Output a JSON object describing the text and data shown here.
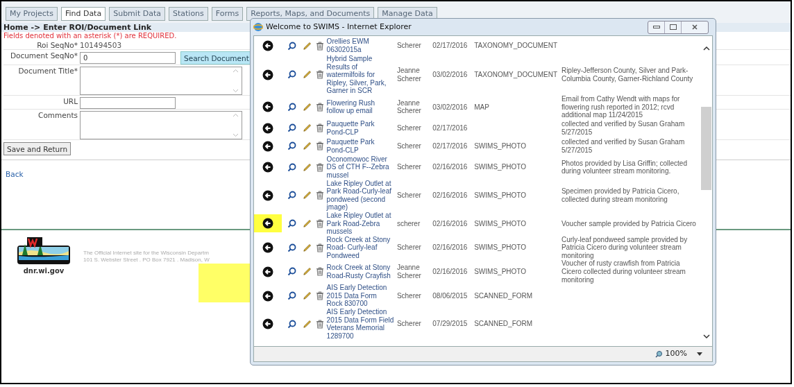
{
  "main_tabs": [
    {
      "label": "My Projects",
      "selected": false
    },
    {
      "label": "Find Data",
      "selected": true
    },
    {
      "label": "Submit Data",
      "selected": false
    },
    {
      "label": "Stations",
      "selected": false
    },
    {
      "label": "Forms",
      "selected": false
    },
    {
      "label": "Reports, Maps, and Documents",
      "selected": false
    },
    {
      "label": "Manage Data",
      "selected": false
    }
  ],
  "breadcrumb": "Home -> Enter ROI/Document Link",
  "required_note": "Fields denoted with an asterisk (*) are REQUIRED.",
  "form_fields": [
    {
      "kind": "static",
      "label": "Roi SeqNo*",
      "value": "101494503"
    },
    {
      "kind": "input",
      "label": "Document SeqNo*",
      "value": "0",
      "button": "Search Document"
    },
    {
      "kind": "textarea",
      "label": "Document Title*"
    },
    {
      "kind": "input",
      "label": "URL"
    },
    {
      "kind": "textarea",
      "label": "Comments"
    }
  ],
  "save_button": "Save and Return",
  "back_link": "Back",
  "footer": {
    "logo_caption": "dnr.wi.gov",
    "lines": [
      "The Official Internet site for the Wisconsin Departm",
      "101 S. Webster Street . PO Box 7921 . Madison, W"
    ],
    "highlighted": true
  },
  "popup": {
    "title": "Welcome to SWIMS - Internet Explorer",
    "zoom": "100%",
    "rows": [
      {
        "title": "Orellies EWM 06302015a",
        "author": "Scherer",
        "date": "02/17/2016",
        "type": "TAXONOMY_DOCUMENT",
        "highlighted": false
      },
      {
        "title": "Hybrid Sample Results of watermilfoils for Ripley, Silver, Park, Garner in SCR",
        "author": "Jeanne Scherer",
        "date": "03/02/2016",
        "type": "TAXONOMY_DOCUMENT",
        "comments": "Ripley-Jefferson County, Silver and Park-Columbia County, Garner-Richland County",
        "highlighted": false
      },
      {
        "title": "Flowering Rush follow up email",
        "author": "Jeanne Scherer",
        "date": "03/02/2016",
        "type": "MAP",
        "comments": "Email from Cathy Wendt with maps for flowering rush reported in 2012; rcvd additional map 11/24/2015",
        "highlighted": false
      },
      {
        "title": "Pauquette Park Pond-CLP",
        "author": "Scherer",
        "date": "02/17/2016",
        "comments": "collected and verified by Susan Graham 5/27/2015",
        "highlighted": false
      },
      {
        "title": "Pauquette Park Pond-CLP",
        "author": "Scherer",
        "date": "02/17/2016",
        "type": "SWIMS_PHOTO",
        "comments": "collected and verified by Susan Graham 5/27/2015",
        "highlighted": false
      },
      {
        "title": "Oconomowoc River DS of CTH F--Zebra mussel",
        "author": "Scherer",
        "date": "02/16/2016",
        "type": "SWIMS_PHOTO",
        "comments": "Photos provided by Lisa Griffin; collected during volunteer stream monitoring.",
        "highlighted": false
      },
      {
        "title": "Lake Ripley Outlet at Park Road-Curly-leaf pondweed (second jmage)",
        "author": "Scherer",
        "date": "02/16/2016",
        "type": "SWIMS_PHOTO",
        "comments": "Specimen provided by Patricia Cicero, collected during stream monitoring",
        "highlighted": false
      },
      {
        "title": "Lake Ripley Outlet at Park Road-Zebra mussels",
        "author": "scherer",
        "date": "02/16/2016",
        "type": "SWIMS_PHOTO",
        "comments": "Voucher sample provided by Patricia Cicero",
        "highlighted": true
      },
      {
        "title": "Rock Creek at Stony Road- Curly-leaf Pondweed",
        "author": "Scherer",
        "date": "02/16/2016",
        "type": "SWIMS_PHOTO",
        "comments": "Curly-leaf pondweed sample provided by Patricia Cicero during volunteer stream monitoring",
        "highlighted": false
      },
      {
        "title": "Rock Creek at Stony Road-Rusty Crayfish",
        "author": "Jeanne Scherer",
        "date": "02/16/2016",
        "type": "SWIMS_PHOTO",
        "comments": "Voucher of rusty crawfish from Patricia Cicero collected during volunteer stream monitoring",
        "highlighted": false
      },
      {
        "title": "AIS Early Detection 2015 Data Form Rock 830700",
        "author": "Scherer",
        "date": "08/06/2015",
        "type": "SCANNED_FORM",
        "highlighted": false
      },
      {
        "title": "AIS Early Detection 2015 Data Form Field Veterans Memorial 1289700",
        "author": "Scherer",
        "date": "07/29/2015",
        "type": "SCANNED_FORM",
        "highlighted": false
      }
    ]
  }
}
